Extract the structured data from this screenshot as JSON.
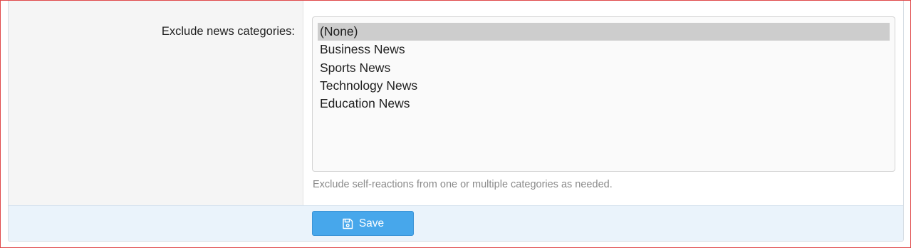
{
  "form": {
    "field_label": "Exclude news categories:",
    "options": [
      {
        "label": "(None)",
        "selected": true
      },
      {
        "label": "Business News",
        "selected": false
      },
      {
        "label": "Sports News",
        "selected": false
      },
      {
        "label": "Technology News",
        "selected": false
      },
      {
        "label": "Education News",
        "selected": false
      }
    ],
    "hint": "Exclude self-reactions from one or multiple categories as needed."
  },
  "footer": {
    "save_label": "Save",
    "save_icon": "floppy-disk-icon"
  },
  "colors": {
    "accent": "#47a7eb",
    "frame_border": "#e0494b",
    "selected_option": "#cdcdcd",
    "footer_bg": "#eaf3fb"
  }
}
